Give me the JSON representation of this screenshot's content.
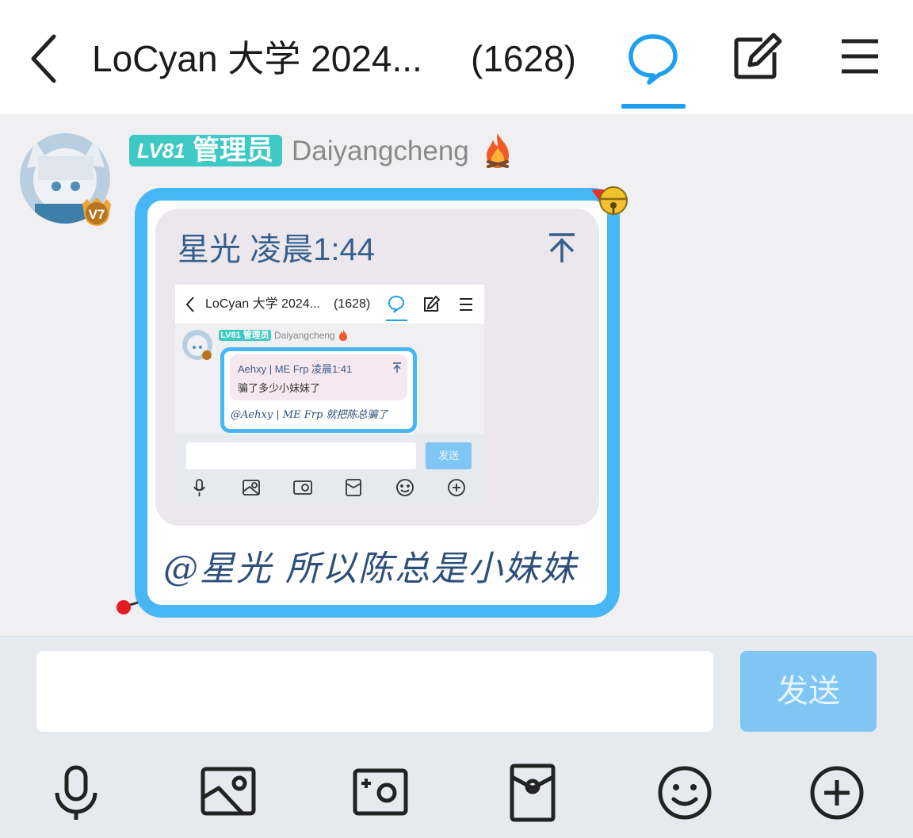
{
  "header": {
    "title": "LoCyan 大学 2024...",
    "member_count": "(1628)"
  },
  "message": {
    "level_badge": "LV81",
    "role_badge": "管理员",
    "sender_name": "Daiyangcheng",
    "avatar_badge": "V7",
    "quote": {
      "author_time": "星光 凌晨1:44",
      "screenshot": {
        "title": "LoCyan 大学 2024...",
        "member_count": "(1628)",
        "level_role": "LV81 管理员",
        "sender_name": "Daiyangcheng",
        "quote_header": "Aehxy | ME Frp 凌晨1:41",
        "quote_body": "骗了多少小妹妹了",
        "message": "@Aehxy | ME Frp 就把陈总骗了",
        "send_label": "发送"
      }
    },
    "text": "@星光 所以陈总是小妹妹"
  },
  "input_bar": {
    "placeholder": "",
    "send_label": "发送",
    "tools": [
      "microphone-icon",
      "image-icon",
      "camera-icon",
      "red-packet-icon",
      "emoji-icon",
      "plus-icon"
    ]
  },
  "colors": {
    "accent": "#1ea0ee",
    "bubble_border": "#47b6f4",
    "badge": "#3fc9c4",
    "send_button": "#7fc6f4",
    "quote_text": "#365f8c"
  }
}
